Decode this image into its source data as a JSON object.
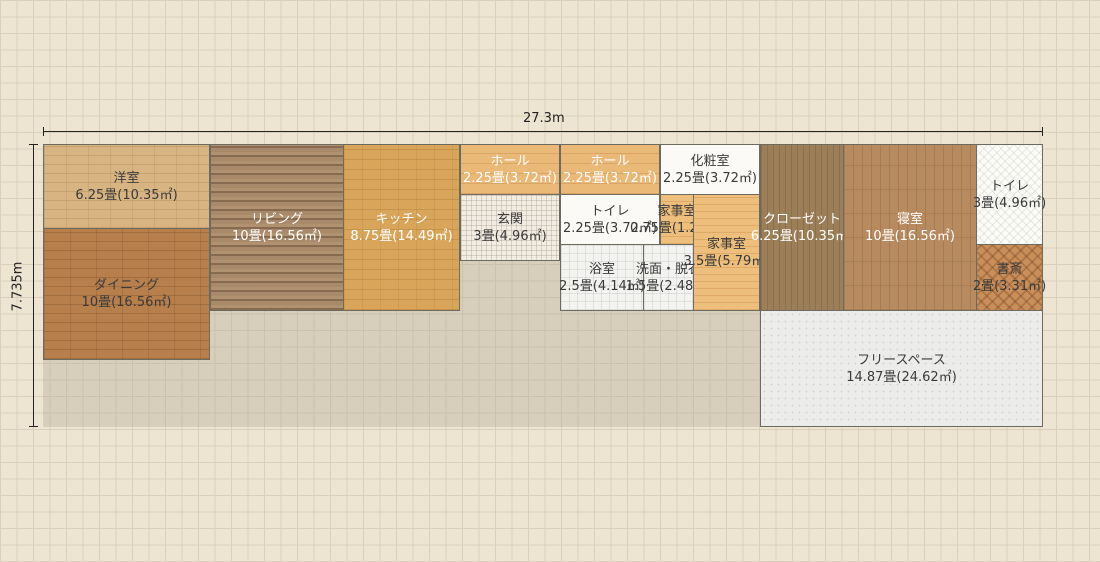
{
  "dimensions": {
    "width_label": "27.3m",
    "height_label": "7.735m"
  },
  "rooms": {
    "yoshitsu": {
      "name": "洋室",
      "size": "6.25畳(10.35㎡)"
    },
    "dining": {
      "name": "ダイニング",
      "size": "10畳(16.56㎡)"
    },
    "living": {
      "name": "リビング",
      "size": "10畳(16.56㎡)"
    },
    "kitchen": {
      "name": "キッチン",
      "size": "8.75畳(14.49㎡)"
    },
    "hall1": {
      "name": "ホール",
      "size": "2.25畳(3.72㎡)"
    },
    "genkan": {
      "name": "玄関",
      "size": "3畳(4.96㎡)"
    },
    "hall2": {
      "name": "ホール",
      "size": "2.25畳(3.72㎡)"
    },
    "toilet1": {
      "name": "トイレ",
      "size": "2.25畳(3.72㎡)"
    },
    "bath": {
      "name": "浴室",
      "size": "2.5畳(4.14㎡)"
    },
    "powder": {
      "name": "化粧室",
      "size": "2.25畳(3.72㎡)"
    },
    "kajishitsu_sm": {
      "name": "家事室",
      "size": "0.75畳(1.24㎡)"
    },
    "senmen": {
      "name": "洗面・脱衣",
      "size": "1.5畳(2.48㎡)"
    },
    "kajishitsu": {
      "name": "家事室",
      "size": "3.5畳(5.79㎡)"
    },
    "closet": {
      "name": "クローゼット",
      "size": "6.25畳(10.35㎡)"
    },
    "bedroom": {
      "name": "寝室",
      "size": "10畳(16.56㎡)"
    },
    "toilet2": {
      "name": "トイレ",
      "size": "3畳(4.96㎡)"
    },
    "study": {
      "name": "書斎",
      "size": "2畳(3.31㎡)"
    },
    "freespace": {
      "name": "フリースペース",
      "size": "14.87畳(24.62㎡)"
    }
  }
}
